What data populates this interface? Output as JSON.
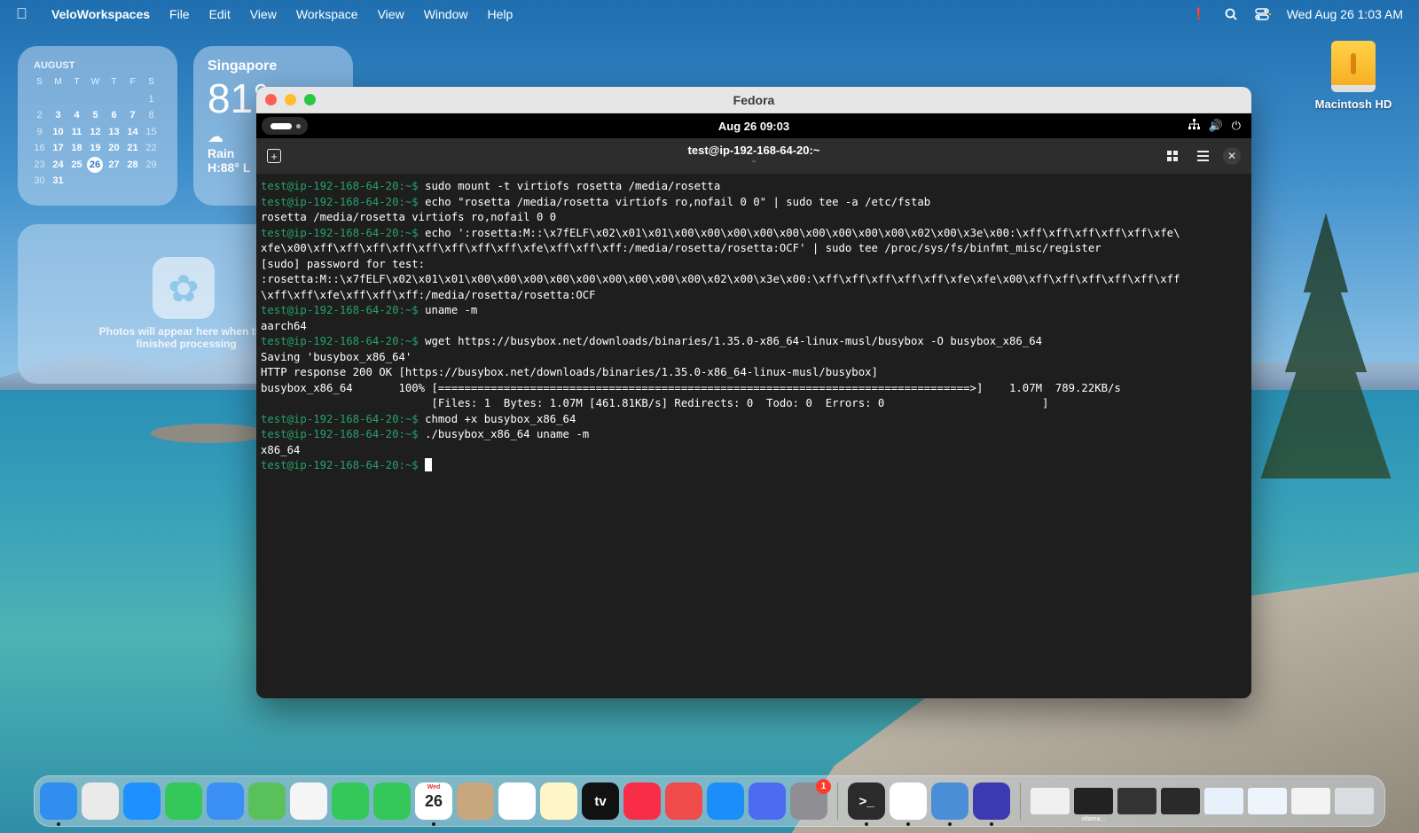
{
  "menubar": {
    "app_name": "VeloWorkspaces",
    "menus": [
      "File",
      "Edit",
      "View",
      "Workspace",
      "View",
      "Window",
      "Help"
    ],
    "datetime": "Wed Aug 26  1:03 AM",
    "icons": [
      "apple-icon",
      "alert-icon",
      "search-icon",
      "control-center-icon"
    ]
  },
  "calendar_widget": {
    "month": "AUGUST",
    "weekday_headers": [
      "S",
      "M",
      "T",
      "W",
      "T",
      "F",
      "S"
    ],
    "today": "26",
    "days": [
      [
        "",
        "",
        "",
        "",
        "",
        "",
        "1"
      ],
      [
        "2",
        "3",
        "4",
        "5",
        "6",
        "7",
        "8"
      ],
      [
        "9",
        "10",
        "11",
        "12",
        "13",
        "14",
        "15"
      ],
      [
        "16",
        "17",
        "18",
        "19",
        "20",
        "21",
        "22"
      ],
      [
        "23",
        "24",
        "25",
        "26",
        "27",
        "28",
        "29"
      ],
      [
        "30",
        "31",
        "",
        "",
        "",
        "",
        ""
      ]
    ]
  },
  "weather_widget": {
    "city": "Singapore",
    "temperature": "81°",
    "condition": "Rain",
    "high_low": "H:88° L"
  },
  "photos_widget": {
    "message": "Photos will appear here when they finished processing"
  },
  "desktop": {
    "disk_label": "Macintosh HD"
  },
  "vm_window": {
    "title": "Fedora",
    "gnome": {
      "clock": "Aug 26  09:03"
    },
    "terminal": {
      "title": "test@ip-192-168-64-20:~",
      "subtitle": "~",
      "prompt": "test@ip-192-168-64-20:~$",
      "lines": [
        {
          "prompt": true,
          "text": " sudo mount -t virtiofs rosetta /media/rosetta"
        },
        {
          "prompt": true,
          "text": " echo \"rosetta /media/rosetta virtiofs ro,nofail 0 0\" | sudo tee -a /etc/fstab"
        },
        {
          "prompt": false,
          "text": "rosetta /media/rosetta virtiofs ro,nofail 0 0"
        },
        {
          "prompt": true,
          "text": " echo ':rosetta:M::\\x7fELF\\x02\\x01\\x01\\x00\\x00\\x00\\x00\\x00\\x00\\x00\\x00\\x00\\x02\\x00\\x3e\\x00:\\xff\\xff\\xff\\xff\\xff\\xfe\\"
        },
        {
          "prompt": false,
          "text": "xfe\\x00\\xff\\xff\\xff\\xff\\xff\\xff\\xff\\xff\\xfe\\xff\\xff\\xff:/media/rosetta/rosetta:OCF' | sudo tee /proc/sys/fs/binfmt_misc/register"
        },
        {
          "prompt": false,
          "text": "[sudo] password for test:"
        },
        {
          "prompt": false,
          "text": ":rosetta:M::\\x7fELF\\x02\\x01\\x01\\x00\\x00\\x00\\x00\\x00\\x00\\x00\\x00\\x00\\x02\\x00\\x3e\\x00:\\xff\\xff\\xff\\xff\\xff\\xfe\\xfe\\x00\\xff\\xff\\xff\\xff\\xff\\xff"
        },
        {
          "prompt": false,
          "text": "\\xff\\xff\\xfe\\xff\\xff\\xff:/media/rosetta/rosetta:OCF"
        },
        {
          "prompt": true,
          "text": " uname -m"
        },
        {
          "prompt": false,
          "text": "aarch64"
        },
        {
          "prompt": true,
          "text": " wget https://busybox.net/downloads/binaries/1.35.0-x86_64-linux-musl/busybox -O busybox_x86_64"
        },
        {
          "prompt": false,
          "text": "Saving 'busybox_x86_64'"
        },
        {
          "prompt": false,
          "text": "HTTP response 200 OK [https://busybox.net/downloads/binaries/1.35.0-x86_64-linux-musl/busybox]"
        },
        {
          "prompt": false,
          "text": "busybox_x86_64       100% [=================================================================================>]    1.07M  789.22KB/s"
        },
        {
          "prompt": false,
          "text": "                          [Files: 1  Bytes: 1.07M [461.81KB/s] Redirects: 0  Todo: 0  Errors: 0                        ]"
        },
        {
          "prompt": true,
          "text": " chmod +x busybox_x86_64"
        },
        {
          "prompt": true,
          "text": " ./busybox_x86_64 uname -m"
        },
        {
          "prompt": false,
          "text": "x86_64"
        },
        {
          "prompt": true,
          "text": " ",
          "cursor": true
        }
      ]
    }
  },
  "dock": {
    "apps": [
      {
        "icon": "finder-icon",
        "color": "#2f8ef0",
        "running": true
      },
      {
        "icon": "launchpad-icon",
        "color": "#eaeaea",
        "running": false
      },
      {
        "icon": "safari-icon",
        "color": "#1e90ff",
        "running": false
      },
      {
        "icon": "messages-icon",
        "color": "#34c759",
        "running": false
      },
      {
        "icon": "mail-icon",
        "color": "#3b8ef3",
        "running": false
      },
      {
        "icon": "maps-icon",
        "color": "#5ac05a",
        "running": false
      },
      {
        "icon": "photos-icon",
        "color": "#f5f5f5",
        "running": false
      },
      {
        "icon": "facetime-icon",
        "color": "#34c759",
        "running": false
      },
      {
        "icon": "phone-icon",
        "color": "#34c759",
        "running": false
      },
      {
        "icon": "calendar-icon",
        "color": "#ffffff",
        "running": true,
        "text": "26",
        "sub": "Wed"
      },
      {
        "icon": "contacts-icon",
        "color": "#c8a77c",
        "running": false
      },
      {
        "icon": "reminders-icon",
        "color": "#ffffff",
        "running": false
      },
      {
        "icon": "notes-icon",
        "color": "#fff6c8",
        "running": false
      },
      {
        "icon": "apple-tv-icon",
        "color": "#111111",
        "running": false,
        "text": "tv"
      },
      {
        "icon": "music-icon",
        "color": "#fa2d48",
        "running": false
      },
      {
        "icon": "rocket-icon",
        "color": "#f04b4b",
        "running": false
      },
      {
        "icon": "app-store-icon",
        "color": "#1c8ef9",
        "running": false
      },
      {
        "icon": "iphone-mirroring-icon",
        "color": "#4b6cf0",
        "running": false
      },
      {
        "icon": "system-settings-icon",
        "color": "#8e8e93",
        "running": false,
        "badge": "1"
      }
    ],
    "recent": [
      {
        "icon": "terminal-icon",
        "color": "#2b2b2b",
        "running": true,
        "text": ">_"
      },
      {
        "icon": "textedit-icon",
        "color": "#ffffff",
        "running": true
      },
      {
        "icon": "veloworkspaces-icon",
        "color": "#4a8ed8",
        "running": true
      },
      {
        "icon": "velo-app-icon",
        "color": "#3c3ab0",
        "running": true
      }
    ],
    "thumbs": [
      {
        "icon": "file-thumb-icon",
        "color": "#f0f0f0",
        "caption": ""
      },
      {
        "icon": "window-thumb-icon",
        "color": "#222222",
        "caption": "ollama..."
      },
      {
        "icon": "window-thumb-icon",
        "color": "#333333",
        "caption": ""
      },
      {
        "icon": "window-thumb-icon",
        "color": "#2a2a2a",
        "caption": ""
      },
      {
        "icon": "window-thumb-icon",
        "color": "#e8f1fb",
        "caption": ""
      },
      {
        "icon": "window-thumb-icon",
        "color": "#eef4fb",
        "caption": ""
      },
      {
        "icon": "window-thumb-icon",
        "color": "#f3f3f3",
        "caption": ""
      },
      {
        "icon": "trash-icon",
        "color": "#d9dde2",
        "caption": ""
      }
    ]
  }
}
